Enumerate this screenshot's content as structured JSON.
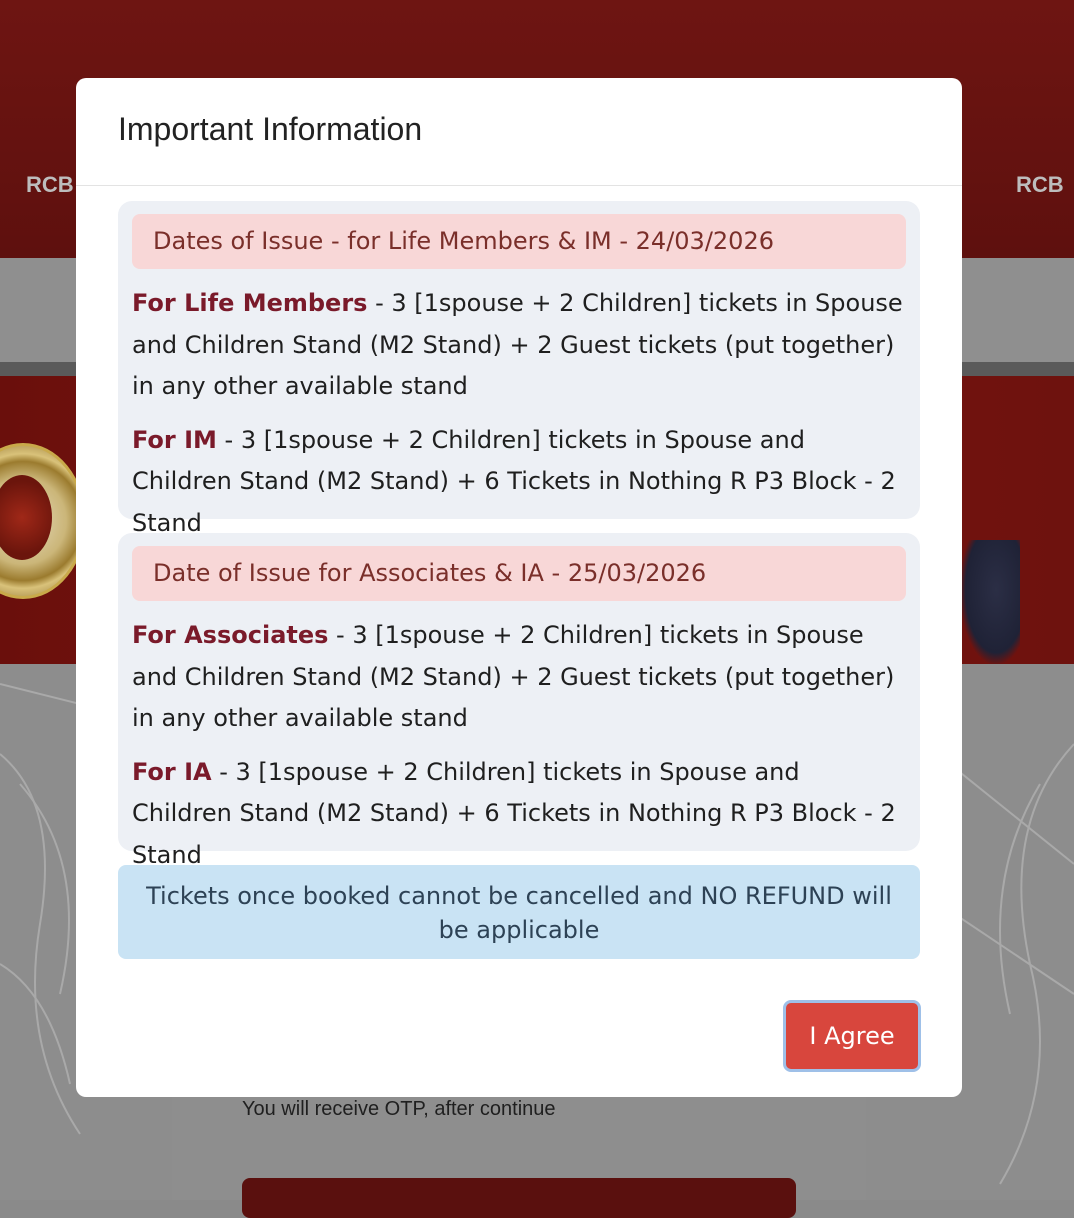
{
  "background": {
    "header_logo_left": "RCB",
    "header_logo_right": "RCB",
    "otp_note": "You will receive OTP, after continue"
  },
  "modal": {
    "title": "Important Information",
    "sections": [
      {
        "heading": "Dates of Issue - for Life Members & IM - 24/03/2026",
        "items": [
          {
            "label": "For Life Members",
            "text": " - 3 [1spouse + 2 Children] tickets in Spouse and Children Stand (M2 Stand) + 2 Guest tickets (put together) in any other available stand"
          },
          {
            "label": "For IM",
            "text": " - 3 [1spouse + 2 Children] tickets in Spouse and Children Stand (M2 Stand) + 6 Tickets in Nothing R P3 Block - 2 Stand"
          }
        ]
      },
      {
        "heading": "Date of Issue for Associates & IA - 25/03/2026",
        "items": [
          {
            "label": "For Associates",
            "text": " - 3 [1spouse + 2 Children] tickets in Spouse and Children Stand (M2 Stand) + 2 Guest tickets (put together) in any other available stand"
          },
          {
            "label": "For IA",
            "text": " - 3 [1spouse + 2 Children] tickets in Spouse and Children Stand (M2 Stand) + 6 Tickets in Nothing R P3 Block - 2 Stand"
          }
        ]
      }
    ],
    "notice": "Tickets once booked cannot be cancelled and NO REFUND will be applicable",
    "agree_button": "I Agree"
  },
  "colors": {
    "header_red": "#6e1512",
    "section_bg": "#edf0f5",
    "heading_bg": "#f8d7d7",
    "label_color": "#7a1a2a",
    "notice_bg": "#c9e3f4",
    "button_bg": "#d8463d"
  }
}
